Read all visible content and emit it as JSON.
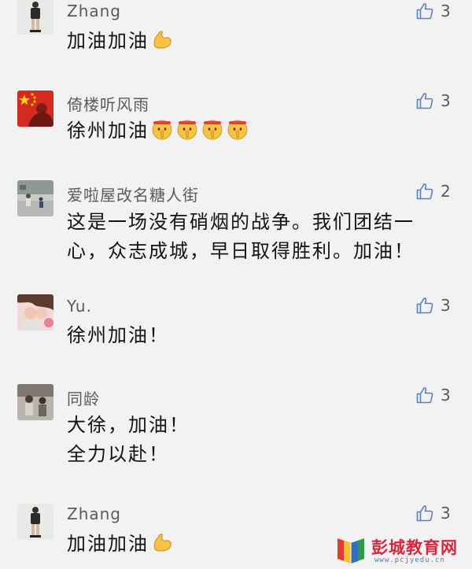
{
  "comments": [
    {
      "username": "Zhang",
      "likes": "3",
      "lines": [
        "加油加油"
      ],
      "emoji": "flexed-biceps-emoji"
    },
    {
      "username": "倚楼听风雨",
      "likes": "3",
      "lines": [
        "徐州加油"
      ],
      "emoji": "shushing-face-emoji"
    },
    {
      "username": "爱啦屋改名糖人街",
      "likes": "2",
      "lines": [
        "这是一场没有硝烟的战争。我们团结一",
        "心，众志成城，早日取得胜利。加油！"
      ]
    },
    {
      "username": "Yu.",
      "likes": "3",
      "lines": [
        "徐州加油！"
      ]
    },
    {
      "username": "同龄",
      "likes": "3",
      "lines": [
        "大徐，加油！",
        "全力以赴！"
      ]
    },
    {
      "username": "Zhang",
      "likes": "3",
      "lines": [
        "加油加油"
      ],
      "emoji": "flexed-biceps-emoji"
    }
  ],
  "watermark": {
    "name": "彭城教育网",
    "url": "www.pcjyedu.cn"
  },
  "icons": {
    "like": "thumbs-up-icon"
  },
  "colors": {
    "background": "#f2f2f2",
    "text": "#121212",
    "muted": "#5a5a5a",
    "like_icon": "#5c7ec4",
    "watermark_red": "#d9263a",
    "watermark_blue": "#4e78b8"
  }
}
